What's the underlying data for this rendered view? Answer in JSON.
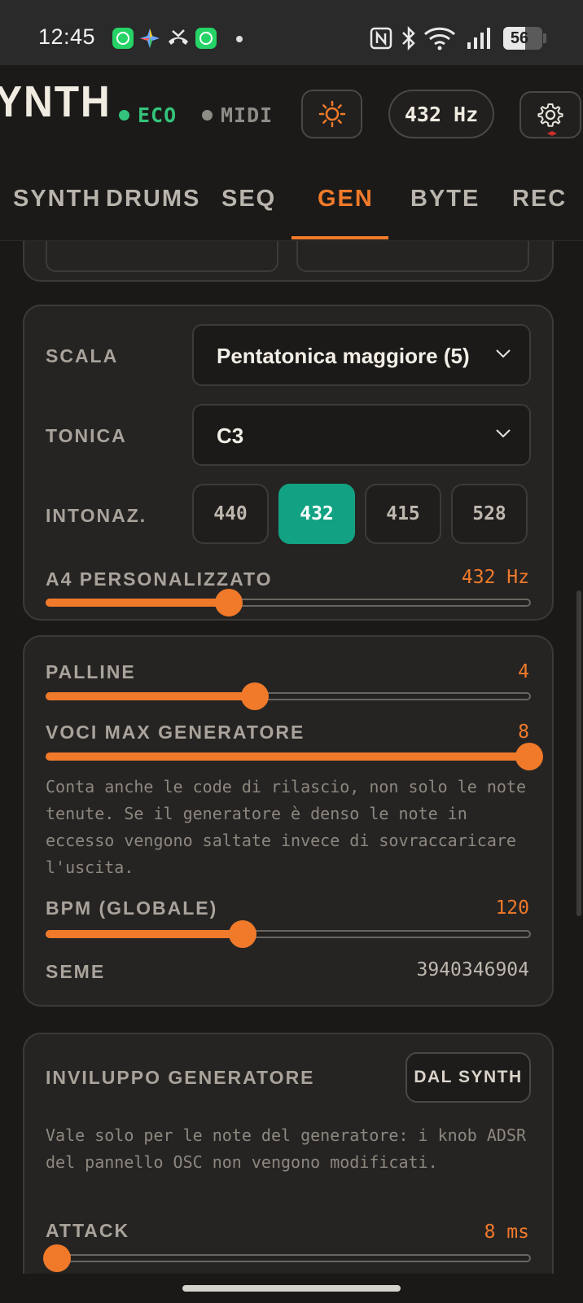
{
  "status_bar": {
    "time": "12:45",
    "battery": "56",
    "icons": [
      "whatsapp-icon",
      "sparkle-icon",
      "missed-call-icon",
      "whatsapp-icon",
      "nfc-icon",
      "bluetooth-icon",
      "wifi-icon",
      "signal-icon"
    ]
  },
  "header": {
    "brand": "YNTH",
    "eco_label": "ECO",
    "midi_label": "MIDI",
    "tuning_label": "432 Hz",
    "colors": {
      "accent": "#f07a2a",
      "eco": "#34c37a",
      "inactive": "#8f8b86"
    }
  },
  "tabs": [
    {
      "label": "SYNTH",
      "active": false
    },
    {
      "label": "DRUMS",
      "active": false
    },
    {
      "label": "SEQ",
      "active": false
    },
    {
      "label": "GEN",
      "active": true
    },
    {
      "label": "BYTE",
      "active": false
    },
    {
      "label": "REC",
      "active": false
    }
  ],
  "scale_card": {
    "scala_label": "SCALA",
    "scala_value": "Pentatonica maggiore (5)",
    "tonica_label": "TONICA",
    "tonica_value": "C3",
    "intonaz_label": "INTONAZ.",
    "intonaz_options": [
      "440",
      "432",
      "415",
      "528"
    ],
    "intonaz_selected": "432",
    "intonaz_active_color": "#12a283",
    "a4_label": "A4 PERSONALIZZATO",
    "a4_value": "432 Hz",
    "a4_fraction": 0.377
  },
  "gen_card": {
    "palline_label": "PALLINE",
    "palline_value": "4",
    "palline_fraction": 0.43,
    "voci_label": "VOCI MAX GENERATORE",
    "voci_value": "8",
    "voci_fraction": 1.0,
    "voci_note": "Conta anche le code di rilascio, non solo le note tenute. Se il generatore è denso le note in eccesso vengono saltate invece di sovraccaricare l'uscita.",
    "bpm_label": "BPM (GLOBALE)",
    "bpm_value": "120",
    "bpm_fraction": 0.405,
    "seme_label": "SEME",
    "seme_value": "3940346904"
  },
  "env_card": {
    "title": "INVILUPPO GENERATORE",
    "dal_synth_label": "DAL SYNTH",
    "note": "Vale solo per le note del generatore: i knob ADSR del pannello OSC non vengono modificati.",
    "attack_label": "ATTACK",
    "attack_value": "8 ms",
    "attack_fraction": 0.02
  }
}
